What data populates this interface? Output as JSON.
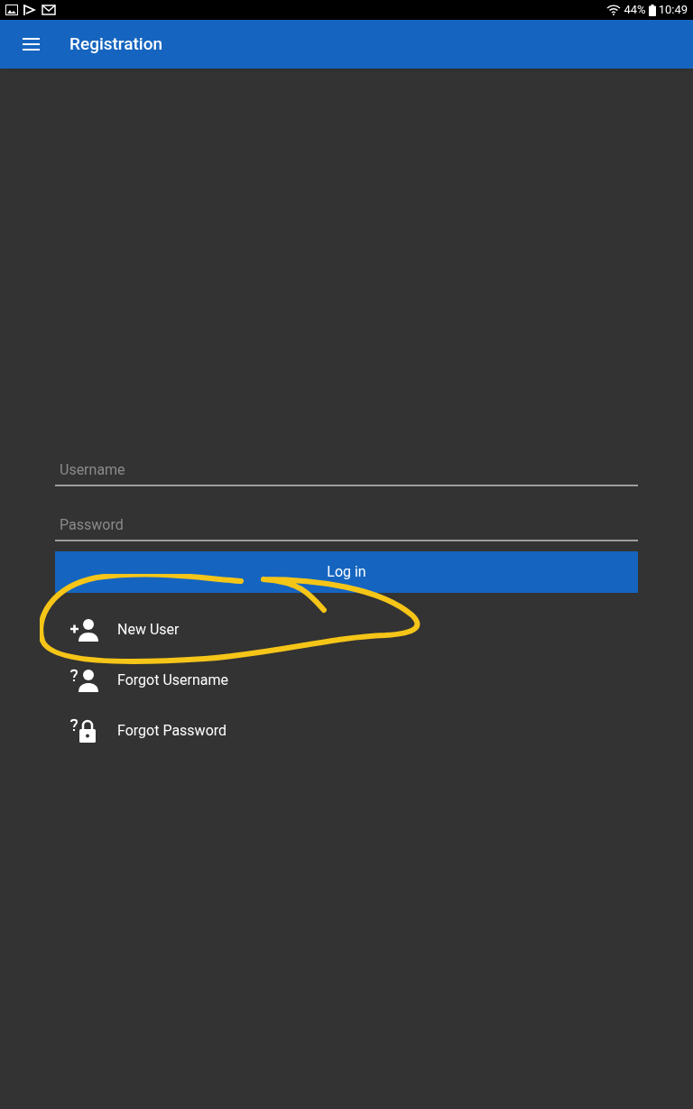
{
  "status_bar": {
    "battery": "44%",
    "time": "10:49"
  },
  "app_bar": {
    "title": "Registration"
  },
  "form": {
    "fields": [
      {
        "placeholder": "Username"
      },
      {
        "placeholder": "Password"
      }
    ],
    "button": "Log in",
    "links": [
      {
        "kind": "add-person",
        "label": "New User"
      },
      {
        "kind": "question-person",
        "label": "Forgot Username"
      },
      {
        "kind": "question-lock",
        "label": "Forgot Password"
      }
    ]
  }
}
